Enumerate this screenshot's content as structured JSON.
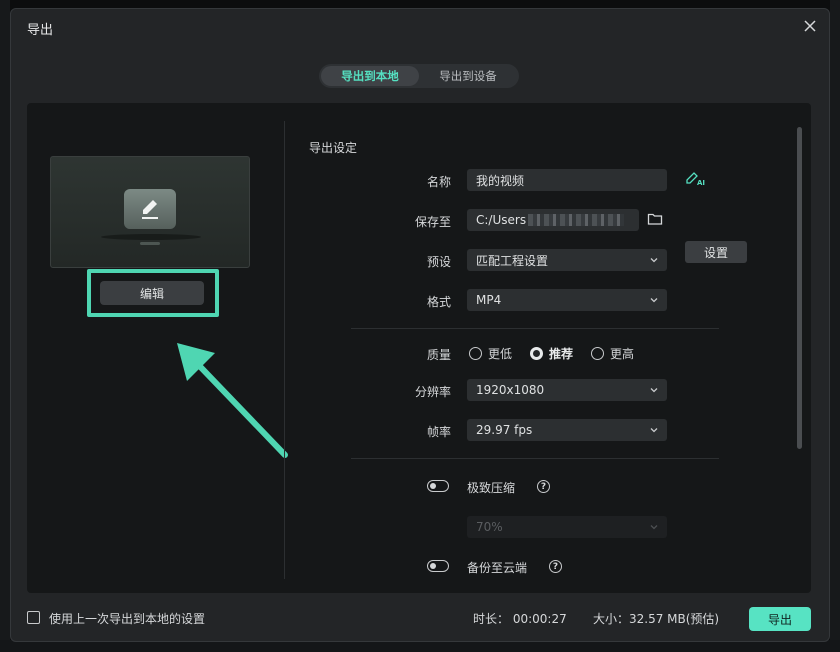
{
  "dialog": {
    "title": "导出",
    "tabs": [
      {
        "label": "导出到本地",
        "active": true
      },
      {
        "label": "导出到设备",
        "active": false
      }
    ]
  },
  "preview": {
    "edit_label": "编辑"
  },
  "settings": {
    "section_title": "导出设定",
    "name_label": "名称",
    "name_value": "我的视频",
    "save_label": "保存至",
    "save_value": "C:/Users",
    "preset_label": "预设",
    "preset_value": "匹配工程设置",
    "settings_button": "设置",
    "format_label": "格式",
    "format_value": "MP4",
    "quality_label": "质量",
    "quality_options": [
      {
        "label": "更低",
        "selected": false
      },
      {
        "label": "推荐",
        "selected": true
      },
      {
        "label": "更高",
        "selected": false
      }
    ],
    "resolution_label": "分辨率",
    "resolution_value": "1920x1080",
    "framerate_label": "帧率",
    "framerate_value": "29.97 fps",
    "compress_label": "极致压缩",
    "compress_value": "70%",
    "cloud_label": "备份至云端"
  },
  "footer": {
    "checkbox_label": "使用上一次导出到本地的设置",
    "duration": "时长：  00:00:27",
    "size": "大小：32.57 MB(预估)",
    "export_label": "导出"
  },
  "colors": {
    "accent": "#57e3c3",
    "highlight": "#4fd6b2"
  }
}
